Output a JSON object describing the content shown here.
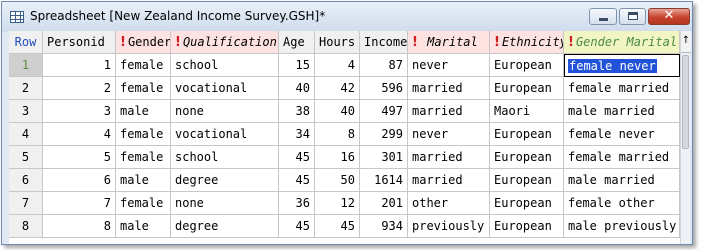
{
  "window": {
    "title": "Spreadsheet [New Zealand Income Survey.GSH]*",
    "icon": "spreadsheet-icon",
    "minimize_glyph": "",
    "close_glyph": "✕"
  },
  "grid": {
    "row_header_label": "Row",
    "columns": [
      {
        "label": "Personid",
        "flag": ""
      },
      {
        "label": "Gender",
        "flag": "!"
      },
      {
        "label": "Qualification",
        "flag": "!"
      },
      {
        "label": "Age",
        "flag": ""
      },
      {
        "label": "Hours",
        "flag": ""
      },
      {
        "label": "Income",
        "flag": ""
      },
      {
        "label": "Marital",
        "flag": "!"
      },
      {
        "label": "Ethnicity",
        "flag": "!"
      },
      {
        "label": "Gender Marital",
        "flag": "!"
      }
    ],
    "pin_glyph": "↑",
    "rows": [
      {
        "row": "1",
        "cells": [
          "1",
          "female",
          "school",
          "15",
          "4",
          "87",
          "never",
          "European",
          "female never"
        ]
      },
      {
        "row": "2",
        "cells": [
          "2",
          "female",
          "vocational",
          "40",
          "42",
          "596",
          "married",
          "European",
          "female married"
        ]
      },
      {
        "row": "3",
        "cells": [
          "3",
          "male",
          "none",
          "38",
          "40",
          "497",
          "married",
          "Maori",
          "male married"
        ]
      },
      {
        "row": "4",
        "cells": [
          "4",
          "female",
          "vocational",
          "34",
          "8",
          "299",
          "never",
          "European",
          "female never"
        ]
      },
      {
        "row": "5",
        "cells": [
          "5",
          "female",
          "school",
          "45",
          "16",
          "301",
          "married",
          "European",
          "female married"
        ]
      },
      {
        "row": "6",
        "cells": [
          "6",
          "male",
          "degree",
          "45",
          "50",
          "1614",
          "married",
          "European",
          "male married"
        ]
      },
      {
        "row": "7",
        "cells": [
          "7",
          "female",
          "none",
          "36",
          "12",
          "201",
          "other",
          "European",
          "female other"
        ]
      },
      {
        "row": "8",
        "cells": [
          "8",
          "male",
          "degree",
          "45",
          "45",
          "934",
          "previously",
          "European",
          "male previously"
        ]
      }
    ],
    "selected": {
      "row": 1,
      "column": "Gender Marital"
    },
    "colors": {
      "selection": "#2252d8",
      "factor_header": "#fde2e2",
      "new_column_header": "#f1f5c4",
      "flag": "#d22020"
    }
  }
}
